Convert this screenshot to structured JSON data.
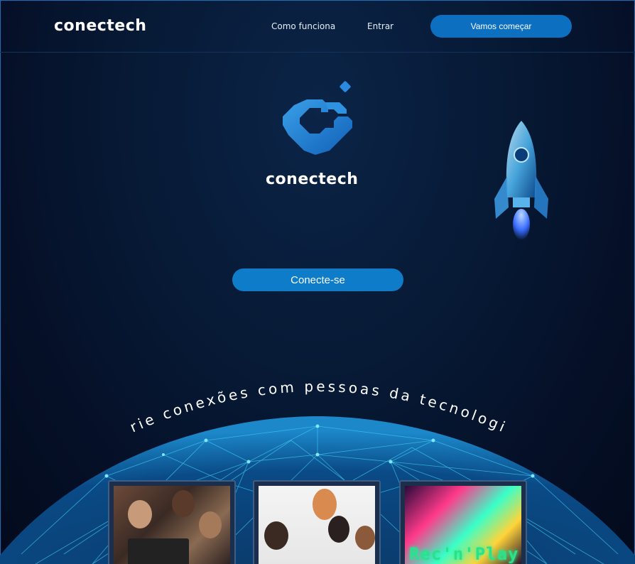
{
  "header": {
    "brand": "conectech",
    "nav": [
      {
        "label": "Como funciona"
      },
      {
        "label": "Entrar"
      }
    ],
    "cta_label": "Vamos começar"
  },
  "hero": {
    "brand": "conectech",
    "connect_label": "Conecte-se"
  },
  "tagline": "Crie conexões com pessoas da tecnologia",
  "cards": [
    {
      "icon": "group-laptop-photo"
    },
    {
      "icon": "group-talking-photo"
    },
    {
      "icon": "recnplay-poster",
      "label": "Rec'n'Play"
    }
  ],
  "colors": {
    "accent": "#0e7cc9",
    "background": "#071a36",
    "globe": "#2ec8f0"
  }
}
